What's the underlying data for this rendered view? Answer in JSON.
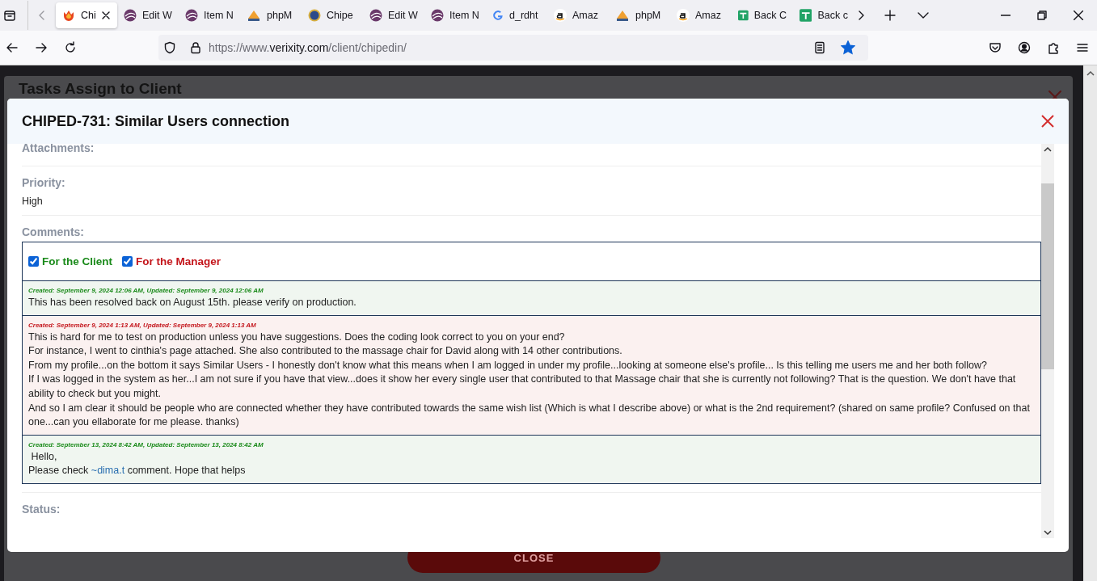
{
  "browser": {
    "tabs": [
      {
        "label": "Chi",
        "kind": "fox",
        "selected": true
      },
      {
        "label": "Edit W",
        "kind": "orb",
        "selected": false
      },
      {
        "label": "Item N",
        "kind": "orb",
        "selected": false
      },
      {
        "label": "phpM",
        "kind": "pma",
        "selected": false
      },
      {
        "label": "Chipe",
        "kind": "globe",
        "selected": false
      },
      {
        "label": "Edit W",
        "kind": "orb",
        "selected": false
      },
      {
        "label": "Item N",
        "kind": "orb",
        "selected": false
      },
      {
        "label": "d_rdht",
        "kind": "g",
        "selected": false
      },
      {
        "label": "Amaz",
        "kind": "a",
        "selected": false
      },
      {
        "label": "phpM",
        "kind": "pma",
        "selected": false
      },
      {
        "label": "Amaz",
        "kind": "a",
        "selected": false
      },
      {
        "label": "Back C",
        "kind": "sheet",
        "selected": false
      },
      {
        "label": "Back c",
        "kind": "sheet",
        "selected": false
      }
    ],
    "url": {
      "scheme": "https://www.",
      "domain": "verixity.com",
      "path": "/client/chipedin/"
    },
    "bookmarked": true
  },
  "background_modal": {
    "title": "Tasks Assign to Client",
    "button": "CLOSE"
  },
  "modal": {
    "title": "CHIPED-731: Similar Users connection",
    "sections": [
      {
        "kind": "field",
        "label": "Attachments:"
      },
      {
        "kind": "field",
        "label": "Priority:",
        "value": "High"
      },
      {
        "kind": "comments",
        "label": "Comments:",
        "filters": [
          {
            "label": "For the Client",
            "checked": true,
            "kind": "client"
          },
          {
            "label": "For the Manager",
            "checked": true,
            "kind": "manager"
          }
        ],
        "comments": [
          {
            "kind": "client",
            "meta": "Created: September 9, 2024 12:06 AM, Updated: September 9, 2024 12:06 AM",
            "paragraphs": [
              [
                {
                  "text": "This has been resolved back on August 15th. please verify on production."
                }
              ]
            ]
          },
          {
            "kind": "manager",
            "meta": "Created: September 9, 2024 1:13 AM, Updated: September 9, 2024 1:13 AM",
            "paragraphs": [
              [
                {
                  "text": "This is hard for me to test on production unless you have suggestions. Does the coding look correct to you on your end?"
                }
              ],
              [
                {
                  "text": "For instance, I went to cinthia's page attached. She also contributed to the massage chair for David along with 14 other contributions."
                }
              ],
              [
                {
                  "text": "From my profile...on the bottom it says Similar Users - I honestly don't know what this means when I am logged in under my profile...looking at someone else's profile... Is this telling me users me and her both follow?"
                }
              ],
              [
                {
                  "text": "If I was logged in the system as her...I am not sure if you have that view...does it show her every single user that contributed to that Massage chair that she is currently not following? That is the question. We don't have that ability to check but you might."
                }
              ],
              [
                {
                  "text": "And so I am clear it should be people who are connected whether they have contributed towards the same wish list (Which is what I describe above) or what is the 2nd requirement? (shared on same profile? Confused on that one...can you ellaborate for me please. thanks)"
                }
              ]
            ]
          },
          {
            "kind": "client",
            "meta": "Created: September 13, 2024 8:42 AM, Updated: September 13, 2024 8:42 AM",
            "paragraphs": [
              [
                {
                  "text": " Hello,"
                }
              ],
              [
                {
                  "text": "Please check "
                },
                {
                  "text": "~dima.t",
                  "link": true
                },
                {
                  "text": " comment. Hope that helps"
                }
              ]
            ]
          }
        ]
      },
      {
        "kind": "field",
        "label": "Status:"
      }
    ]
  }
}
